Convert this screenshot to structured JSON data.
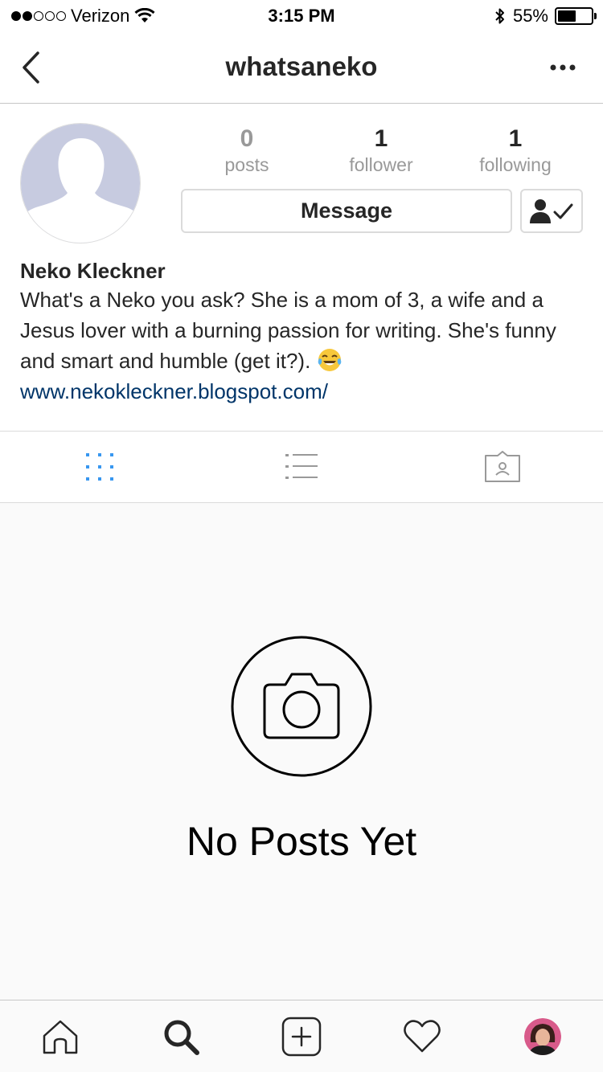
{
  "status_bar": {
    "carrier": "Verizon",
    "signal_bars": "2 of 5",
    "time": "3:15 PM",
    "battery_percent": "55%",
    "battery_level": 0.55
  },
  "nav": {
    "title": "whatsaneko",
    "back_icon": "chevron-left-icon",
    "more_icon": "more-horizontal-icon"
  },
  "profile": {
    "stats": [
      {
        "value": "0",
        "label": "posts"
      },
      {
        "value": "1",
        "label": "follower"
      },
      {
        "value": "1",
        "label": "following"
      }
    ],
    "message_label": "Message",
    "name": "Neko Kleckner",
    "bio": "What's a Neko you ask? She is a mom of 3, a wife and a Jesus lover with a burning passion for writing. She's funny and smart and humble (get it?).",
    "bio_emoji": "face-with-tears-of-joy",
    "link": "www.nekokleckner.blogspot.com/"
  },
  "view_tabs": [
    {
      "name": "grid-icon",
      "active": true
    },
    {
      "name": "list-icon",
      "active": false
    },
    {
      "name": "tagged-icon",
      "active": false
    }
  ],
  "empty_state": {
    "title": "No Posts Yet",
    "icon": "camera-icon"
  },
  "tab_bar": [
    "home-icon",
    "search-icon",
    "add-post-icon",
    "heart-icon",
    "profile-avatar"
  ],
  "colors": {
    "accent": "#3897f0",
    "link": "#003569",
    "muted": "#999999"
  }
}
